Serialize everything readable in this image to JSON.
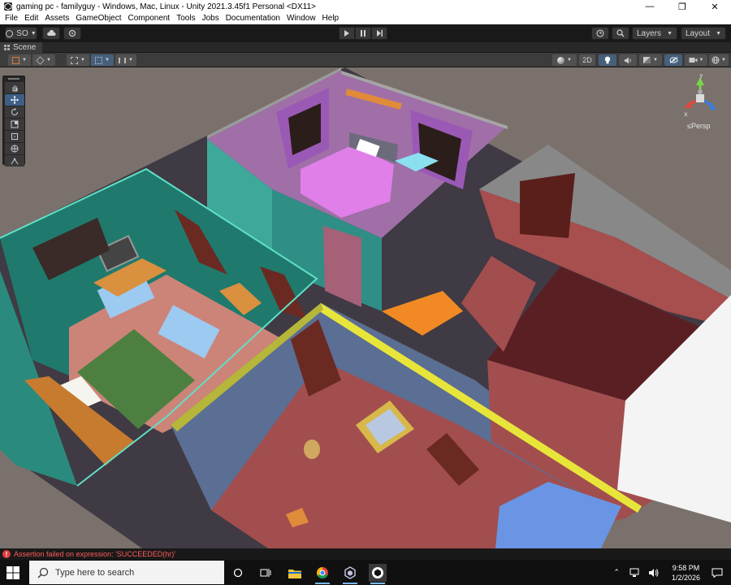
{
  "window": {
    "title": "gaming pc - familyguy - Windows, Mac, Linux - Unity 2021.3.45f1 Personal <DX11>",
    "controls": [
      "—",
      "❐",
      "✕"
    ]
  },
  "menu": [
    "File",
    "Edit",
    "Assets",
    "GameObject",
    "Component",
    "Tools",
    "Jobs",
    "Documentation",
    "Window",
    "Help"
  ],
  "toolbar": {
    "account_label": "SO",
    "layers_label": "Layers",
    "layout_label": "Layout"
  },
  "scene_tab": {
    "label": "Scene"
  },
  "scene_bar": {
    "mode_2d": "2D"
  },
  "gizmo": {
    "y": "y",
    "x": "x",
    "persp": "≤Persp"
  },
  "status": {
    "error_icon": "!",
    "message": "Assertion failed on expression: 'SUCCEEDED(hr)'"
  },
  "taskbar": {
    "search_placeholder": "Type here to search",
    "time": "9:58 PM",
    "date": "1/2/2026"
  },
  "colors": {
    "editor_bg": "#191919",
    "panel": "#3c3c3c",
    "accent_blue": "#3e5e86",
    "error_red": "#ff5a5a",
    "wall_teal": "#1f7a6d",
    "floor_red": "#a24e4e",
    "floor_blue": "#5b6e93",
    "sky_gray": "#7a716c"
  }
}
